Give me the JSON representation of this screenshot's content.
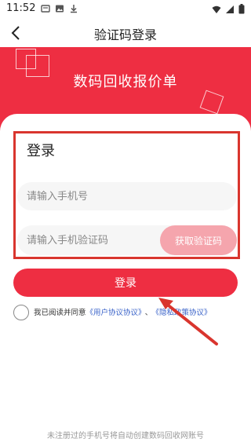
{
  "status_bar": {
    "time": "11:52",
    "left_icons": [
      "notification-icon",
      "image-icon",
      "download-icon"
    ],
    "right_icons": [
      "wifi-icon",
      "signal-icon",
      "battery-icon"
    ]
  },
  "nav": {
    "title": "验证码登录",
    "back_icon": "chevron-left-icon"
  },
  "banner": {
    "title": "数码回收报价单",
    "background_color": "#ee2e42"
  },
  "login_form": {
    "heading": "登录",
    "phone_placeholder": "请输入手机号",
    "code_placeholder": "请输入手机验证码",
    "get_code_label": "获取验证码",
    "login_label": "登录"
  },
  "agreement": {
    "prefix": "我已阅读并同意",
    "user_agreement": "《用户协议协议》",
    "separator": "、",
    "privacy_policy": "《隐私政策协议》"
  },
  "footer": {
    "note": "未注册过的手机号将自动创建数码回收网账号"
  },
  "colors": {
    "accent": "#ee2e42",
    "get_code_button": "#f5a5ad",
    "annotation": "#d9352e",
    "link": "#3a63c9"
  }
}
